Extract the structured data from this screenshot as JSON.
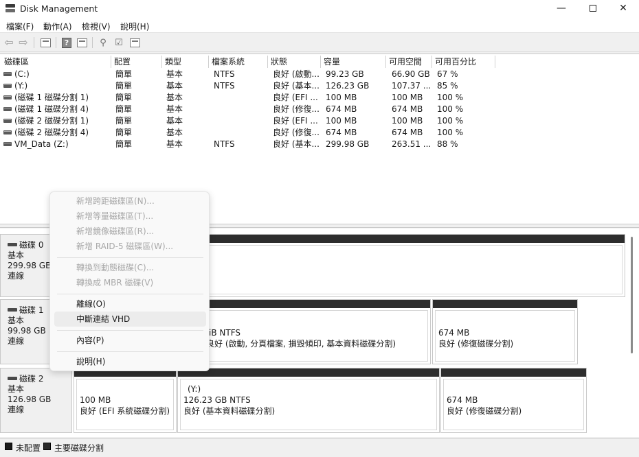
{
  "window": {
    "title": "Disk Management",
    "min": "—",
    "close": "✕"
  },
  "menu": [
    "檔案(F)",
    "動作(A)",
    "檢視(V)",
    "說明(H)"
  ],
  "columns": [
    "磁碟區",
    "配置",
    "類型",
    "檔案系統",
    "狀態",
    "容量",
    "可用空間",
    "可用百分比"
  ],
  "volumes": [
    [
      "(C:)",
      "簡單",
      "基本",
      "NTFS",
      "良好 (啟動...",
      "99.23 GB",
      "66.90 GB",
      "67 %"
    ],
    [
      "(Y:)",
      "簡單",
      "基本",
      "NTFS",
      "良好 (基本...",
      "126.23 GB",
      "107.37 ...",
      "85 %"
    ],
    [
      "(磁碟 1 磁碟分割 1)",
      "簡單",
      "基本",
      "",
      "良好 (EFI ...",
      "100 MB",
      "100 MB",
      "100 %"
    ],
    [
      "(磁碟 1 磁碟分割 4)",
      "簡單",
      "基本",
      "",
      "良好 (修復...",
      "674 MB",
      "674 MB",
      "100 %"
    ],
    [
      "(磁碟 2 磁碟分割 1)",
      "簡單",
      "基本",
      "",
      "良好 (EFI ...",
      "100 MB",
      "100 MB",
      "100 %"
    ],
    [
      "(磁碟 2 磁碟分割 4)",
      "簡單",
      "基本",
      "",
      "良好 (修復...",
      "674 MB",
      "674 MB",
      "100 %"
    ],
    [
      "VM_Data (Z:)",
      "簡單",
      "基本",
      "NTFS",
      "良好 (基本...",
      "299.98 GB",
      "263.51 ...",
      "88 %"
    ]
  ],
  "disks": [
    {
      "name": "磁碟 0",
      "type": "基本",
      "size": "299.98 GB",
      "status": "連線"
    },
    {
      "name": "磁碟 1",
      "type": "基本",
      "size": "99.98 GB",
      "status": "連線"
    },
    {
      "name": "磁碟 2",
      "type": "基本",
      "size": "126.98 GB",
      "status": "連線"
    }
  ],
  "disk1_parts": {
    "main_l1": "iB NTFS",
    "main_l2": "良好 (啟動, 分頁檔案, 損毀傾印, 基本資料磁碟分割)",
    "rec_l1": "674 MB",
    "rec_l2": "良好 (修復磁碟分割)"
  },
  "disk2_parts": {
    "efi_l1": "100 MB",
    "efi_l2": "良好 (EFI 系統磁碟分割)",
    "main_l0": "(Y:)",
    "main_l1": "126.23 GB NTFS",
    "main_l2": "良好 (基本資料磁碟分割)",
    "rec_l1": "674 MB",
    "rec_l2": "良好 (修復磁碟分割)"
  },
  "legend": {
    "unallocated": "未配置",
    "primary": "主要磁碟分割"
  },
  "context_menu": {
    "new_spanned": "新增跨距磁碟區(N)...",
    "new_striped": "新增等量磁碟區(T)...",
    "new_mirrored": "新增鏡像磁碟區(R)...",
    "new_raid5": "新增 RAID-5 磁碟區(W)...",
    "convert_dynamic": "轉換到動態磁碟(C)...",
    "convert_mbr": "轉換成 MBR 磁碟(V)",
    "offline": "離線(O)",
    "detach_vhd": "中斷連結 VHD",
    "properties": "內容(P)",
    "help": "說明(H)"
  }
}
